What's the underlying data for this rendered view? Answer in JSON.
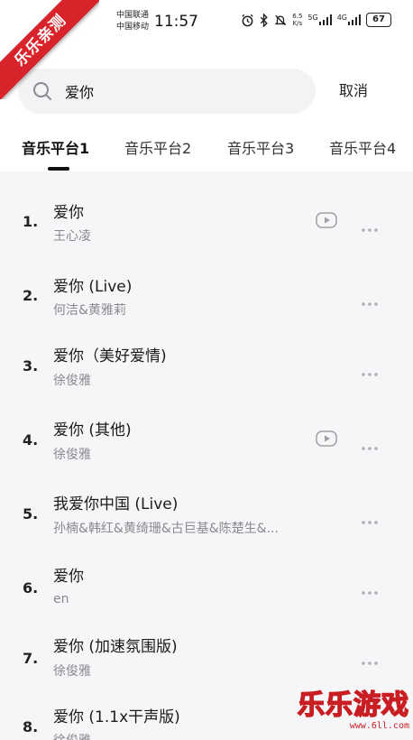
{
  "ribbon": "乐乐亲测",
  "status_bar": {
    "carrier1": "中国联通",
    "carrier2": "中国移动",
    "time": "11:57",
    "net_speed": "6.5",
    "net_unit": "K/s",
    "net1": "5G",
    "net2": "4G",
    "battery": "67"
  },
  "search": {
    "value": "爱你",
    "cancel_label": "取消"
  },
  "tabs": [
    "音乐平台1",
    "音乐平台2",
    "音乐平台3",
    "音乐平台4"
  ],
  "active_tab": 0,
  "results": [
    {
      "num": "1.",
      "title": "爱你",
      "artist": "王心凌",
      "mv": true
    },
    {
      "num": "2.",
      "title": "爱你 (Live)",
      "artist": "何洁&黄雅莉",
      "mv": false
    },
    {
      "num": "3.",
      "title": "爱你（美好爱情)",
      "artist": "徐俊雅",
      "mv": false
    },
    {
      "num": "4.",
      "title": "爱你 (其他)",
      "artist": "徐俊雅",
      "mv": true
    },
    {
      "num": "5.",
      "title": "我爱你中国 (Live)",
      "artist": "孙楠&韩红&黄绮珊&古巨基&陈楚生&...",
      "mv": false
    },
    {
      "num": "6.",
      "title": "爱你",
      "artist": "en",
      "mv": false
    },
    {
      "num": "7.",
      "title": "爱你 (加速氛围版)",
      "artist": "徐俊雅",
      "mv": false
    },
    {
      "num": "8.",
      "title": "爱你 (1.1x干声版)",
      "artist": "徐俊雅",
      "mv": false
    }
  ],
  "watermark": {
    "title": "乐乐游戏",
    "url": "www.6ll.com"
  },
  "icons": {
    "search": "search-icon",
    "mv": "mv-play-icon",
    "more": "more-icon",
    "alarm": "alarm-icon",
    "bluetooth": "bluetooth-icon",
    "mute": "mute-icon"
  }
}
